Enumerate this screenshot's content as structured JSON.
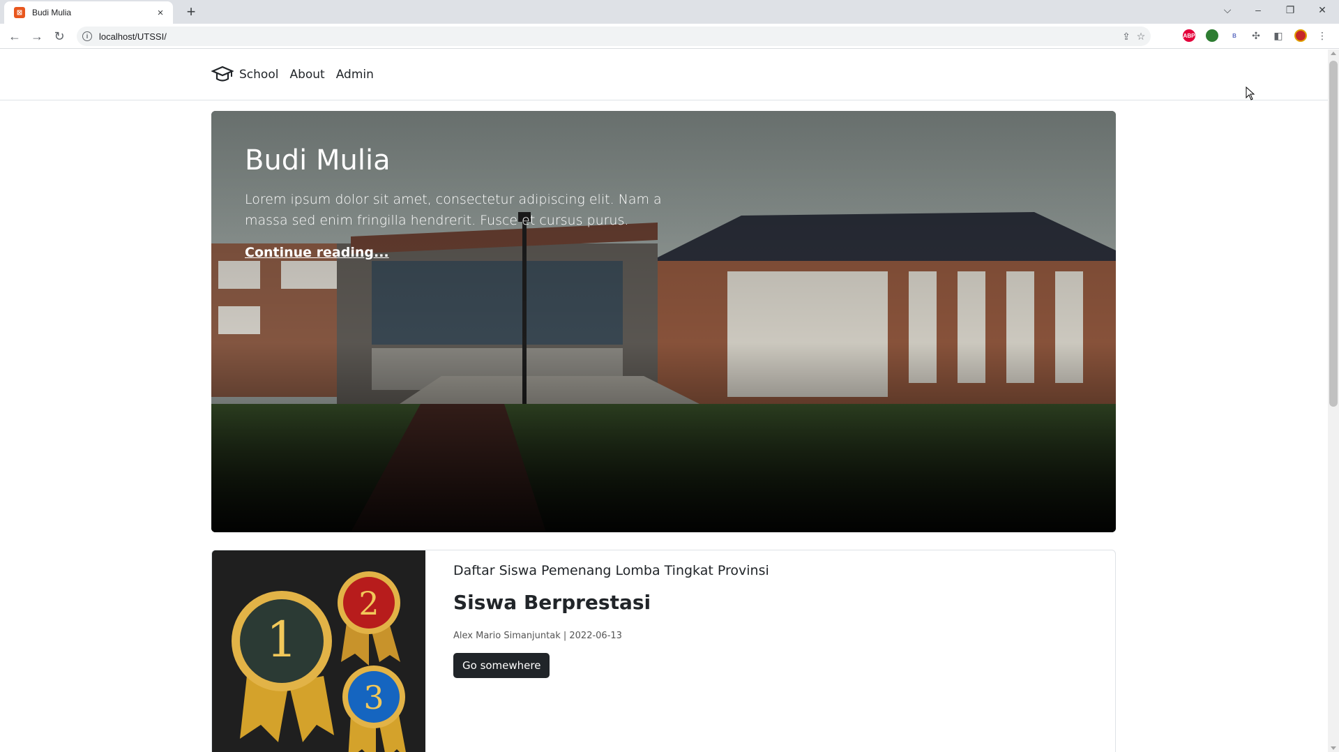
{
  "browser": {
    "tab_title": "Budi Mulia",
    "url": "localhost/UTSSI/",
    "new_tab_symbol": "+",
    "tab_close_symbol": "×",
    "extensions": [
      {
        "name": "adblock-icon",
        "label": "ABP",
        "color": "#e4003b"
      },
      {
        "name": "extension-globe-icon",
        "label": "",
        "color": "#2e7d32"
      },
      {
        "name": "extension-b-icon",
        "label": "B",
        "color": "#ffffff"
      }
    ]
  },
  "site": {
    "brand": "School",
    "nav": [
      {
        "label": "About"
      },
      {
        "label": "Admin"
      }
    ]
  },
  "hero": {
    "title": "Budi Mulia",
    "text": "Lorem ipsum dolor sit amet, consectetur adipiscing elit. Nam a massa sed enim fringilla hendrerit. Fusce et cursus purus.",
    "link": "Continue reading..."
  },
  "card": {
    "subtitle": "Daftar Siswa Pemenang Lomba Tingkat Provinsi",
    "title": "Siswa Berprestasi",
    "meta": "Alex Mario Simanjuntak | 2022-06-13",
    "button": "Go somewhere",
    "medals": [
      "1",
      "2",
      "3"
    ]
  }
}
